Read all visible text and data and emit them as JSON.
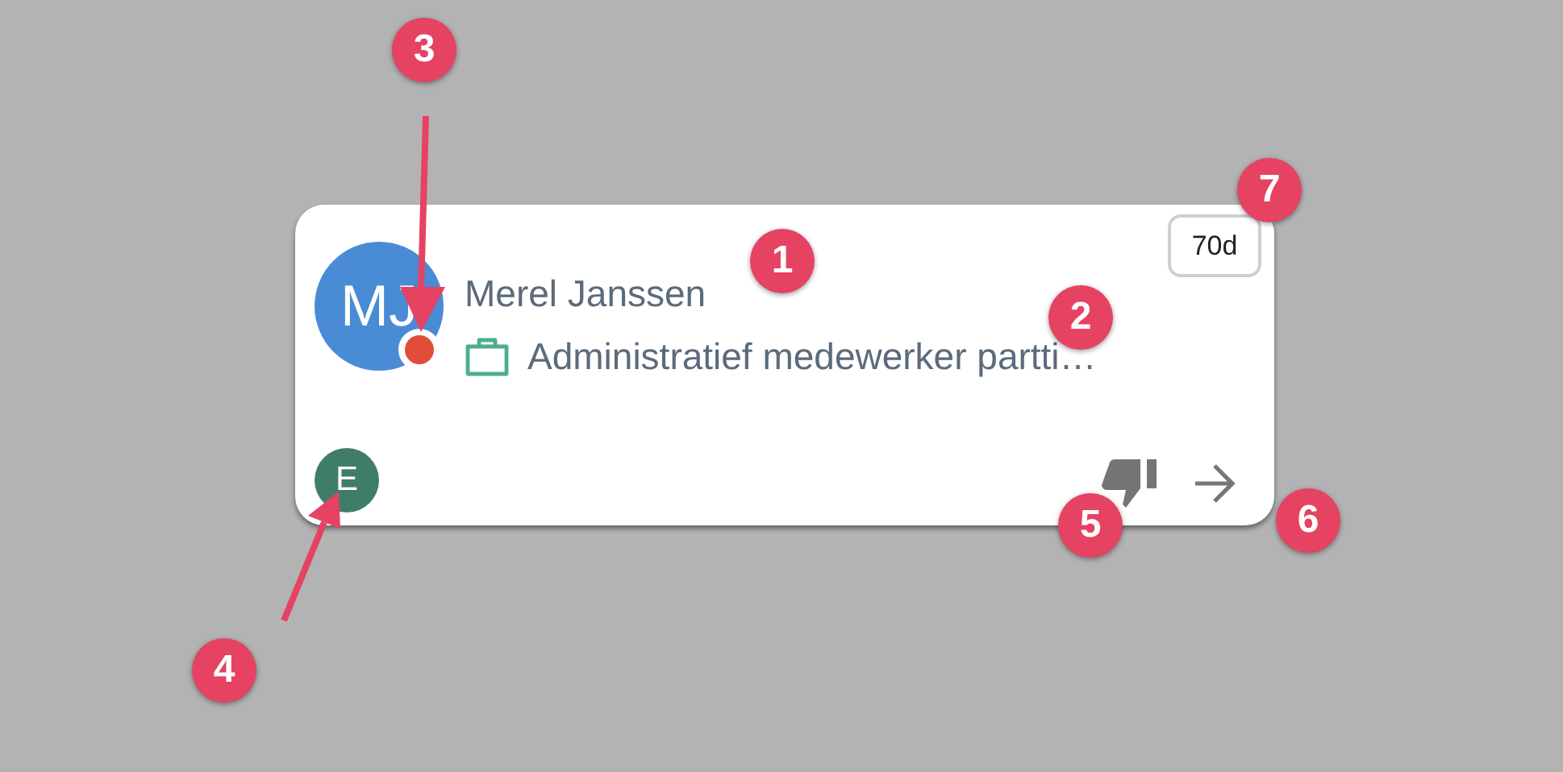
{
  "card": {
    "avatar_initials": "MJ",
    "name": "Merel Janssen",
    "job_title": "Administratief medewerker partti…",
    "age_badge": "70d",
    "assignee_initial": "E"
  },
  "callouts": [
    "1",
    "2",
    "3",
    "4",
    "5",
    "6",
    "7"
  ]
}
